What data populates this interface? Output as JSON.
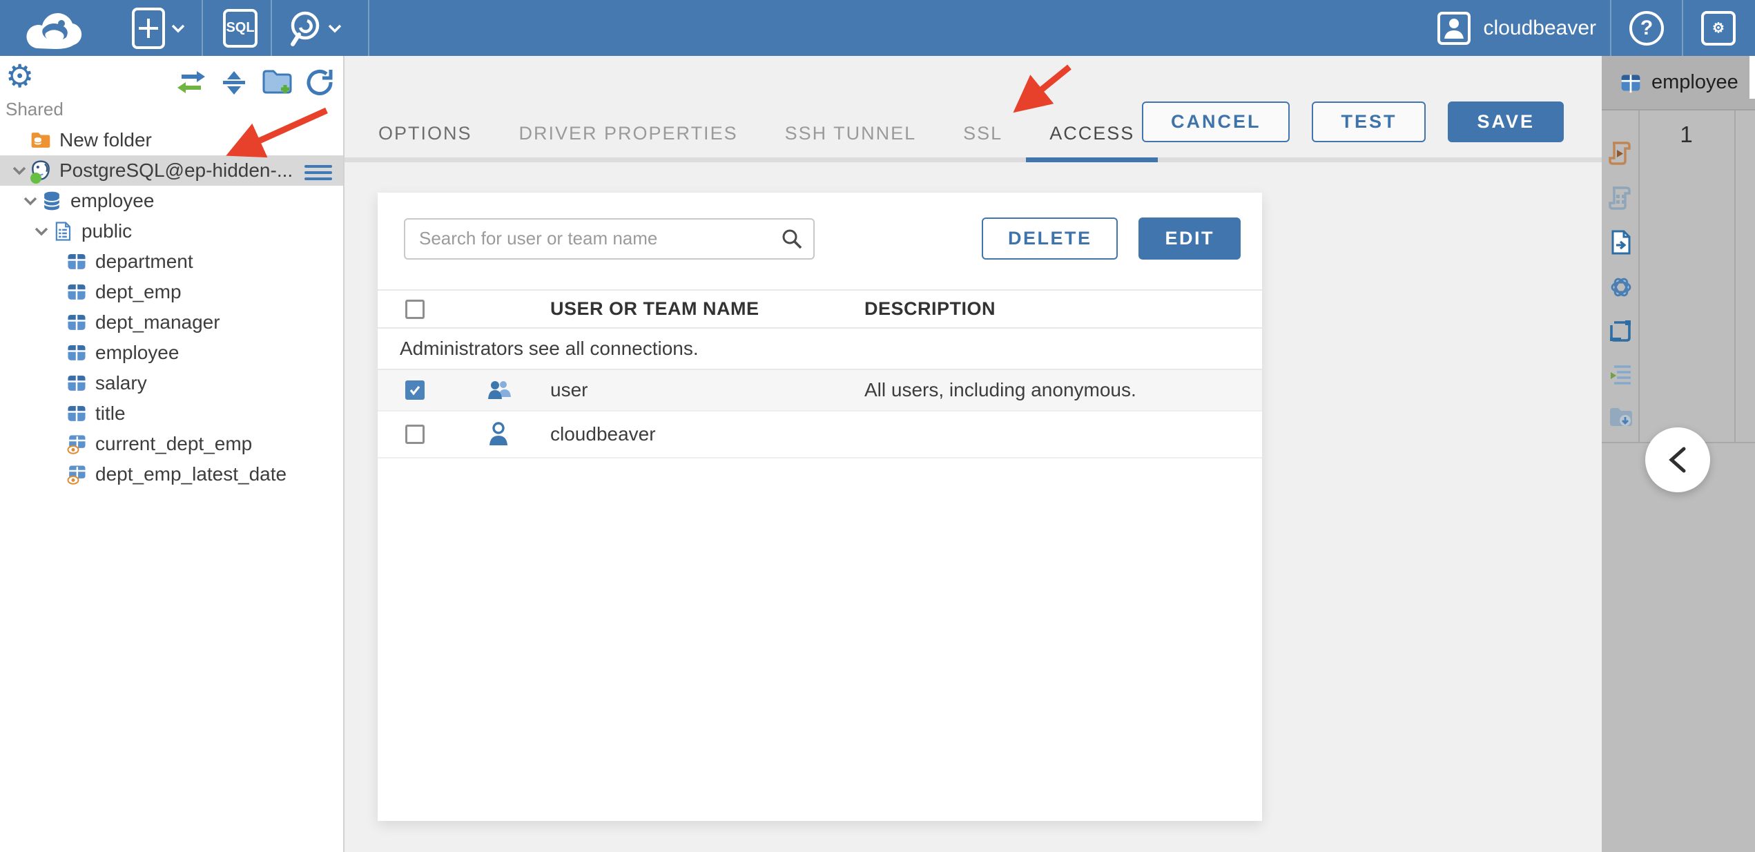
{
  "topbar": {
    "user_name": "cloudbeaver",
    "sql_button_label": "SQL",
    "help_glyph": "?"
  },
  "icons": {
    "gear_glyph": "⚙"
  },
  "sidebar": {
    "section_label": "Shared",
    "tree": [
      {
        "label": "New folder",
        "type": "folder"
      },
      {
        "label": "PostgreSQL@ep-hidden-...",
        "type": "connection",
        "selected": true,
        "status": "connected"
      },
      {
        "label": "employee",
        "type": "database",
        "expanded": true
      },
      {
        "label": "public",
        "type": "schema",
        "expanded": true
      },
      {
        "label": "department",
        "type": "table"
      },
      {
        "label": "dept_emp",
        "type": "table"
      },
      {
        "label": "dept_manager",
        "type": "table"
      },
      {
        "label": "employee",
        "type": "table"
      },
      {
        "label": "salary",
        "type": "table"
      },
      {
        "label": "title",
        "type": "table"
      },
      {
        "label": "current_dept_emp",
        "type": "view"
      },
      {
        "label": "dept_emp_latest_date",
        "type": "view"
      }
    ]
  },
  "editor": {
    "tabs": [
      {
        "label": "OPTIONS"
      },
      {
        "label": "DRIVER PROPERTIES"
      },
      {
        "label": "SSH TUNNEL"
      },
      {
        "label": "SSL"
      },
      {
        "label": "ACCESS",
        "active": true
      }
    ],
    "actions": {
      "cancel": "CANCEL",
      "test": "TEST",
      "save": "SAVE"
    },
    "access": {
      "search_placeholder": "Search for user or team name",
      "delete_label": "DELETE",
      "edit_label": "EDIT",
      "columns": {
        "name": "USER OR TEAM NAME",
        "description": "DESCRIPTION"
      },
      "info_message": "Administrators see all connections.",
      "rows": [
        {
          "name": "user",
          "description": "All users, including anonymous.",
          "checked": true,
          "icon": "team-icon"
        },
        {
          "name": "cloudbeaver",
          "description": "",
          "checked": false,
          "icon": "user-icon"
        }
      ]
    }
  },
  "right_panel": {
    "tab_label": "employee",
    "row_number": "1"
  },
  "colors": {
    "topbar": "#4679b0",
    "accent": "#4076ad",
    "arrow": "#e8412b",
    "status_online": "#66bf43"
  }
}
